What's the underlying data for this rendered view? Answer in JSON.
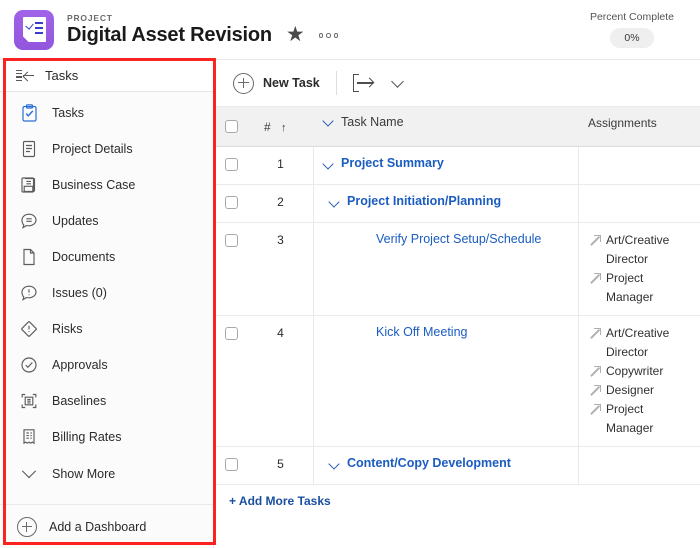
{
  "header": {
    "logo_icon": "project-document-check-icon",
    "eyebrow": "PROJECT",
    "title": "Digital Asset Revision",
    "star_icon": "star-filled-icon",
    "more_icon": "more-options-icon",
    "percent_complete_label": "Percent Complete",
    "percent_complete_value": "0%",
    "accent_purple": "#9256dd"
  },
  "sidebar": {
    "panel_header": {
      "collapse_icon": "collapse-panel-icon",
      "label": "Tasks"
    },
    "items": [
      {
        "label": "Tasks",
        "icon": "clipboard-check-icon",
        "active": true
      },
      {
        "label": "Project Details",
        "icon": "document-lines-icon",
        "active": false
      },
      {
        "label": "Business Case",
        "icon": "inbox-tray-icon",
        "active": false
      },
      {
        "label": "Updates",
        "icon": "comment-bubble-icon",
        "active": false
      },
      {
        "label": "Documents",
        "icon": "file-page-icon",
        "active": false
      },
      {
        "label": "Issues (0)",
        "icon": "issue-bubble-icon",
        "active": false
      },
      {
        "label": "Risks",
        "icon": "diamond-alert-icon",
        "active": false
      },
      {
        "label": "Approvals",
        "icon": "check-circle-icon",
        "active": false
      },
      {
        "label": "Baselines",
        "icon": "baseline-frame-icon",
        "active": false
      },
      {
        "label": "Billing Rates",
        "icon": "receipt-icon",
        "active": false
      }
    ],
    "show_more": {
      "label": "Show More",
      "icon": "chevron-down-icon"
    },
    "add_dashboard": {
      "label": "Add a Dashboard",
      "icon": "plus-circle-icon"
    },
    "highlight_color": "#fb2222"
  },
  "toolbar": {
    "new_task_label": "New Task",
    "new_task_icon": "plus-circle-icon",
    "export_icon": "export-arrow-icon",
    "dropdown_icon": "chevron-down-icon"
  },
  "table": {
    "columns": {
      "number": "#",
      "sort_indicator": "↑",
      "task_name": "Task Name",
      "assignments": "Assignments"
    },
    "rows": [
      {
        "num": "1",
        "name": "Project Summary",
        "indent": 0,
        "expandable": true,
        "bold": true,
        "assignments": []
      },
      {
        "num": "2",
        "name": "Project Initiation/Planning",
        "indent": 1,
        "expandable": true,
        "bold": true,
        "assignments": []
      },
      {
        "num": "3",
        "name": "Verify Project Setup/Schedule",
        "indent": 2,
        "expandable": false,
        "bold": false,
        "assignments": [
          "Art/Creative Director",
          "Project Manager"
        ]
      },
      {
        "num": "4",
        "name": "Kick Off Meeting",
        "indent": 2,
        "expandable": false,
        "bold": false,
        "assignments": [
          "Art/Creative Director",
          "Copywriter",
          "Designer",
          "Project Manager"
        ]
      },
      {
        "num": "5",
        "name": "Content/Copy Development",
        "indent": 1,
        "expandable": true,
        "bold": true,
        "assignments": []
      }
    ],
    "add_more_label": "+ Add More Tasks",
    "link_color": "#1a5cc0"
  }
}
